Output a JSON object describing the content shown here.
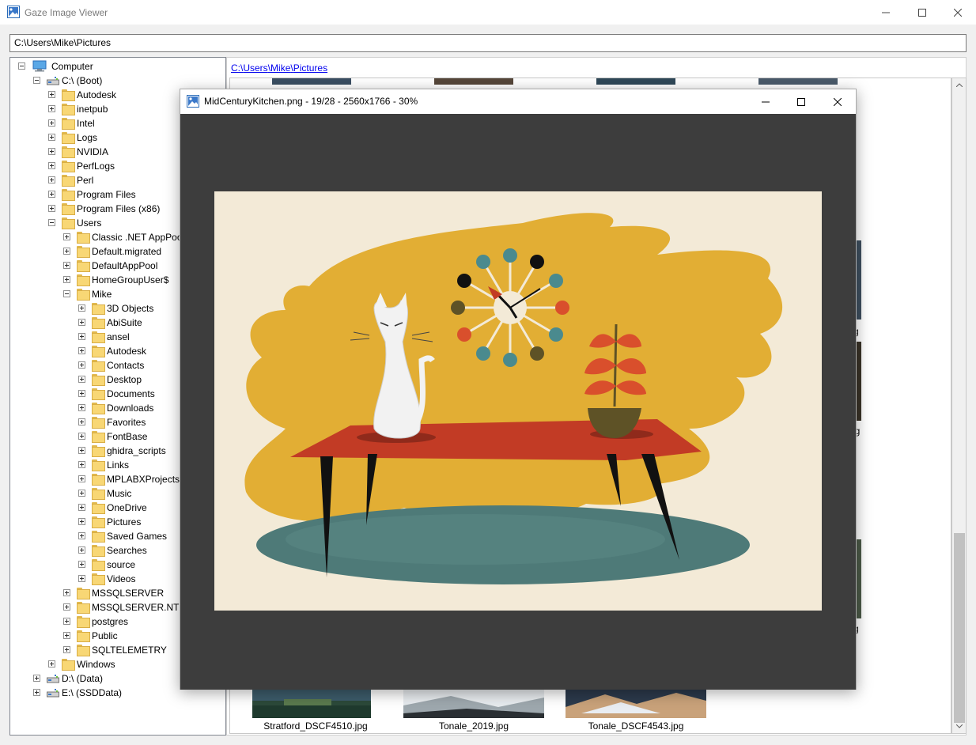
{
  "window": {
    "title": "Gaze Image Viewer",
    "minimize_icon": "minimize-icon",
    "maximize_icon": "maximize-icon",
    "close_icon": "close-icon"
  },
  "address_bar": {
    "value": "C:\\Users\\Mike\\Pictures"
  },
  "breadcrumb": {
    "parts": [
      "C:",
      "Users",
      "Mike",
      "Pictures"
    ],
    "separator": "\\"
  },
  "tree": {
    "root": "Computer",
    "items": [
      {
        "label": "C:\\ (Boot)",
        "level": 1,
        "expanded": true,
        "icon": "drive-icon"
      },
      {
        "label": "Autodesk",
        "level": 2
      },
      {
        "label": "inetpub",
        "level": 2
      },
      {
        "label": "Intel",
        "level": 2
      },
      {
        "label": "Logs",
        "level": 2
      },
      {
        "label": "NVIDIA",
        "level": 2
      },
      {
        "label": "PerfLogs",
        "level": 2
      },
      {
        "label": "Perl",
        "level": 2
      },
      {
        "label": "Program Files",
        "level": 2
      },
      {
        "label": "Program Files (x86)",
        "level": 2
      },
      {
        "label": "Users",
        "level": 2,
        "expanded": true
      },
      {
        "label": "Classic .NET AppPool",
        "level": 3
      },
      {
        "label": "Default.migrated",
        "level": 3
      },
      {
        "label": "DefaultAppPool",
        "level": 3
      },
      {
        "label": "HomeGroupUser$",
        "level": 3
      },
      {
        "label": "Mike",
        "level": 3,
        "expanded": true
      },
      {
        "label": "3D Objects",
        "level": 4
      },
      {
        "label": "AbiSuite",
        "level": 4
      },
      {
        "label": "ansel",
        "level": 4
      },
      {
        "label": "Autodesk",
        "level": 4
      },
      {
        "label": "Contacts",
        "level": 4
      },
      {
        "label": "Desktop",
        "level": 4
      },
      {
        "label": "Documents",
        "level": 4
      },
      {
        "label": "Downloads",
        "level": 4
      },
      {
        "label": "Favorites",
        "level": 4
      },
      {
        "label": "FontBase",
        "level": 4
      },
      {
        "label": "ghidra_scripts",
        "level": 4
      },
      {
        "label": "Links",
        "level": 4
      },
      {
        "label": "MPLABXProjects",
        "level": 4
      },
      {
        "label": "Music",
        "level": 4
      },
      {
        "label": "OneDrive",
        "level": 4
      },
      {
        "label": "Pictures",
        "level": 4
      },
      {
        "label": "Saved Games",
        "level": 4
      },
      {
        "label": "Searches",
        "level": 4
      },
      {
        "label": "source",
        "level": 4
      },
      {
        "label": "Videos",
        "level": 4
      },
      {
        "label": "MSSQLSERVER",
        "level": 3
      },
      {
        "label": "MSSQLSERVER.NT Ser",
        "level": 3
      },
      {
        "label": "postgres",
        "level": 3
      },
      {
        "label": "Public",
        "level": 3
      },
      {
        "label": "SQLTELEMETRY",
        "level": 3
      },
      {
        "label": "Windows",
        "level": 2
      },
      {
        "label": "D:\\ (Data)",
        "level": 1,
        "icon": "drive-icon"
      },
      {
        "label": "E:\\ (SSDData)",
        "level": 1,
        "icon": "drive-icon"
      }
    ]
  },
  "thumbnails": [
    {
      "caption": "Stratford_DSCF4510.jpg",
      "colors": [
        "#1f3a2e",
        "#3d5c6b",
        "#5a7a4e"
      ]
    },
    {
      "caption": "Tonale_2019.jpg",
      "colors": [
        "#e8ecef",
        "#9ea8ae",
        "#2a2f33"
      ]
    },
    {
      "caption": "Tonale_DSCF4543.jpg",
      "colors": [
        "#2c3a4c",
        "#c9a27a",
        "#e9edf2"
      ]
    }
  ],
  "peek_labels": [
    "g",
    "og",
    "g"
  ],
  "viewer": {
    "title": "MidCenturyKitchen.png - 19/28 - 2560x1766 - 30%",
    "colors": {
      "background": "#3d3d3d",
      "cream": "#f3ead7",
      "mustard": "#e2ae34",
      "table": "#c23b25",
      "rug": "#4e7a78",
      "teal": "#4a8a8e"
    }
  }
}
